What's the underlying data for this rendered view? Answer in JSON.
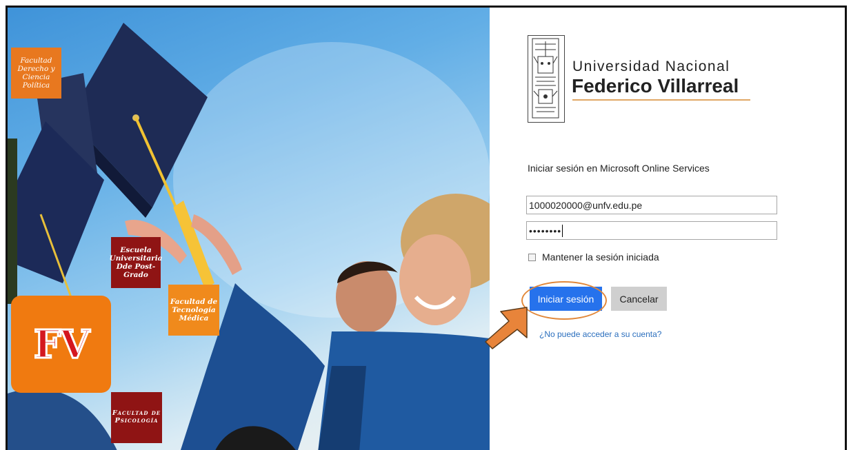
{
  "hero": {
    "tiles": {
      "derecho": "Facultad\nDerecho y\nCiencia\nPolítica",
      "escuela": "Escuela\nUniversitaria\nDde Post-\nGrado",
      "tecnologia": "Facultad de\nTecnología\nMédica",
      "psicologia": "Facultad de\nPsicología"
    },
    "logo_text": "FV"
  },
  "brand": {
    "line1": "Universidad Nacional",
    "line2": "Federico Villarreal",
    "accent_color": "#e0a765"
  },
  "login": {
    "heading": "Iniciar sesión en Microsoft Online Services",
    "username_value": "1000020000@unfv.edu.pe",
    "password_mask": "••••••••",
    "keep_signed_in_label": "Mantener la sesión iniciada",
    "keep_signed_in_checked": false,
    "signin_label": "Iniciar sesión",
    "cancel_label": "Cancelar",
    "help_link": "¿No puede acceder a su cuenta?",
    "primary_color": "#2672ec"
  },
  "annotation": {
    "arrow_color": "#e8843a",
    "icon": "arrow-pointer-icon"
  }
}
